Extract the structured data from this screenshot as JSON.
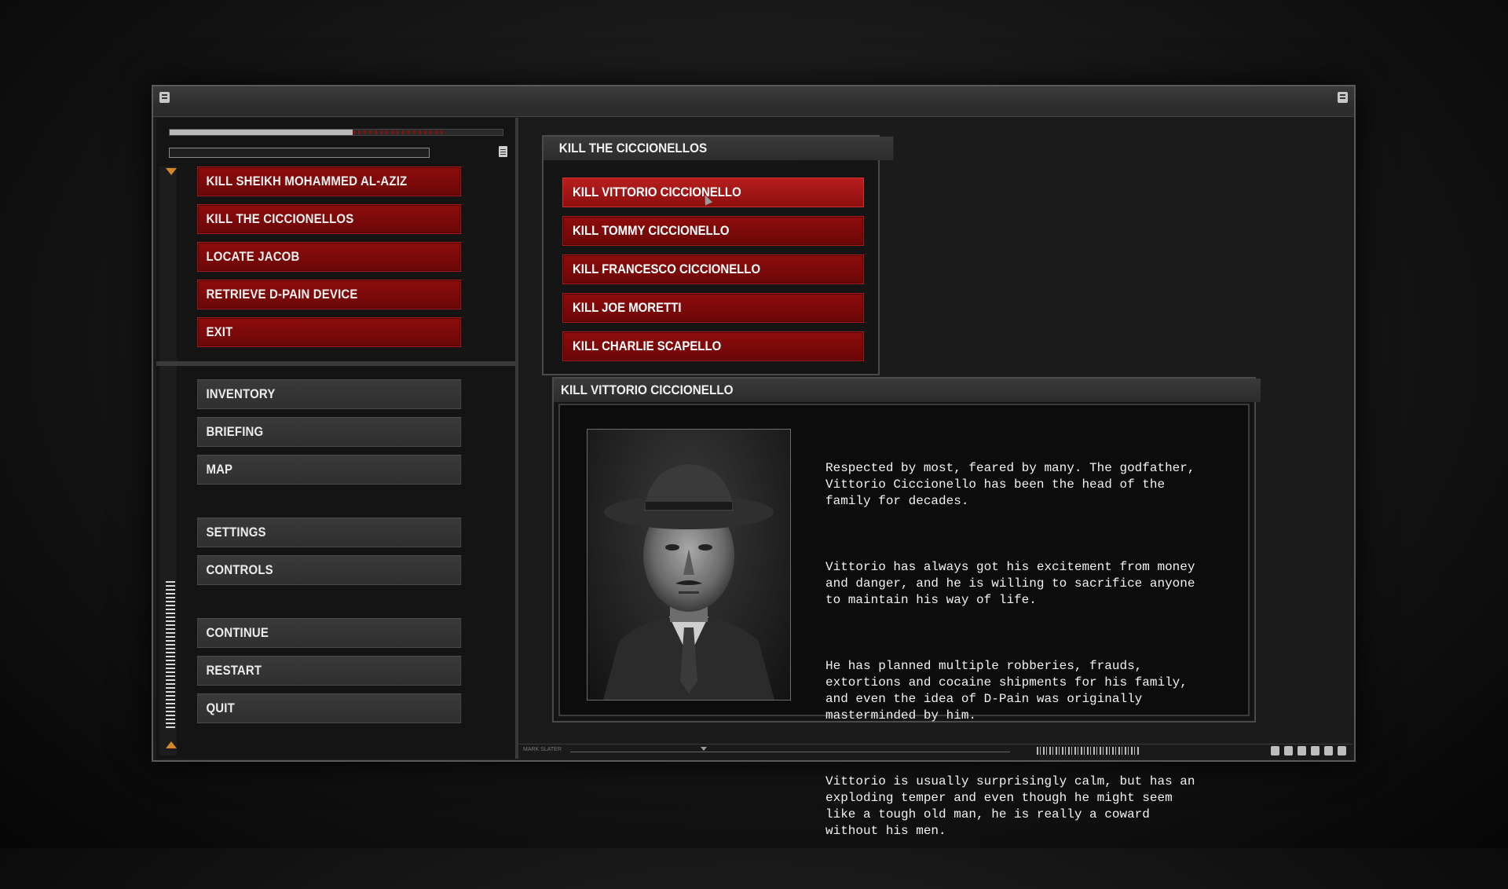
{
  "mission_menu": {
    "items": [
      {
        "label": "KILL SHEIKH MOHAMMED AL-AZIZ"
      },
      {
        "label": "KILL THE CICCIONELLOS"
      },
      {
        "label": "LOCATE JACOB"
      },
      {
        "label": "RETRIEVE D-PAIN DEVICE"
      },
      {
        "label": "EXIT"
      }
    ]
  },
  "game_menu": {
    "items": [
      {
        "label": "INVENTORY"
      },
      {
        "label": "BRIEFING"
      },
      {
        "label": "MAP"
      },
      {
        "label": "SETTINGS"
      },
      {
        "label": "CONTROLS"
      },
      {
        "label": "CONTINUE"
      },
      {
        "label": "RESTART"
      },
      {
        "label": "QUIT"
      }
    ]
  },
  "progress": {
    "value": 0.55
  },
  "contracts": {
    "title": "KILL THE CICCIONELLOS",
    "items": [
      {
        "label": "KILL VITTORIO CICCIONELLO",
        "active": true
      },
      {
        "label": "KILL TOMMY CICCIONELLO"
      },
      {
        "label": "KILL FRANCESCO CICCIONELLO"
      },
      {
        "label": "KILL JOE MORETTI"
      },
      {
        "label": "KILL CHARLIE SCAPELLO"
      }
    ]
  },
  "detail": {
    "title": "KILL VITTORIO CICCIONELLO",
    "bio": [
      "Respected by most, feared by many. The godfather,\nVittorio Ciccionello has been the head of the\nfamily for decades.",
      "Vittorio has always got his excitement from money\nand danger, and he is willing to sacrifice anyone\nto maintain his way of life.",
      "He has planned multiple robberies, frauds,\nextortions and cocaine shipments for his family,\nand even the idea of D-Pain was originally\nmasterminded by him.",
      "Vittorio is usually surprisingly calm, but has an\nexploding temper and even though he might seem\nlike a tough old man, he is really a coward\nwithout his men."
    ]
  },
  "statusbar": {
    "name": "MARK SLATER"
  },
  "colors": {
    "accent_red": "#8f0c0c",
    "active_red": "#b81e1e",
    "arrow": "#d4862a"
  },
  "icons": [
    "user-icon",
    "document-icon",
    "arrow-down-icon",
    "arrow-up-icon",
    "gear-icon",
    "wifi-icon",
    "grid-icon"
  ]
}
